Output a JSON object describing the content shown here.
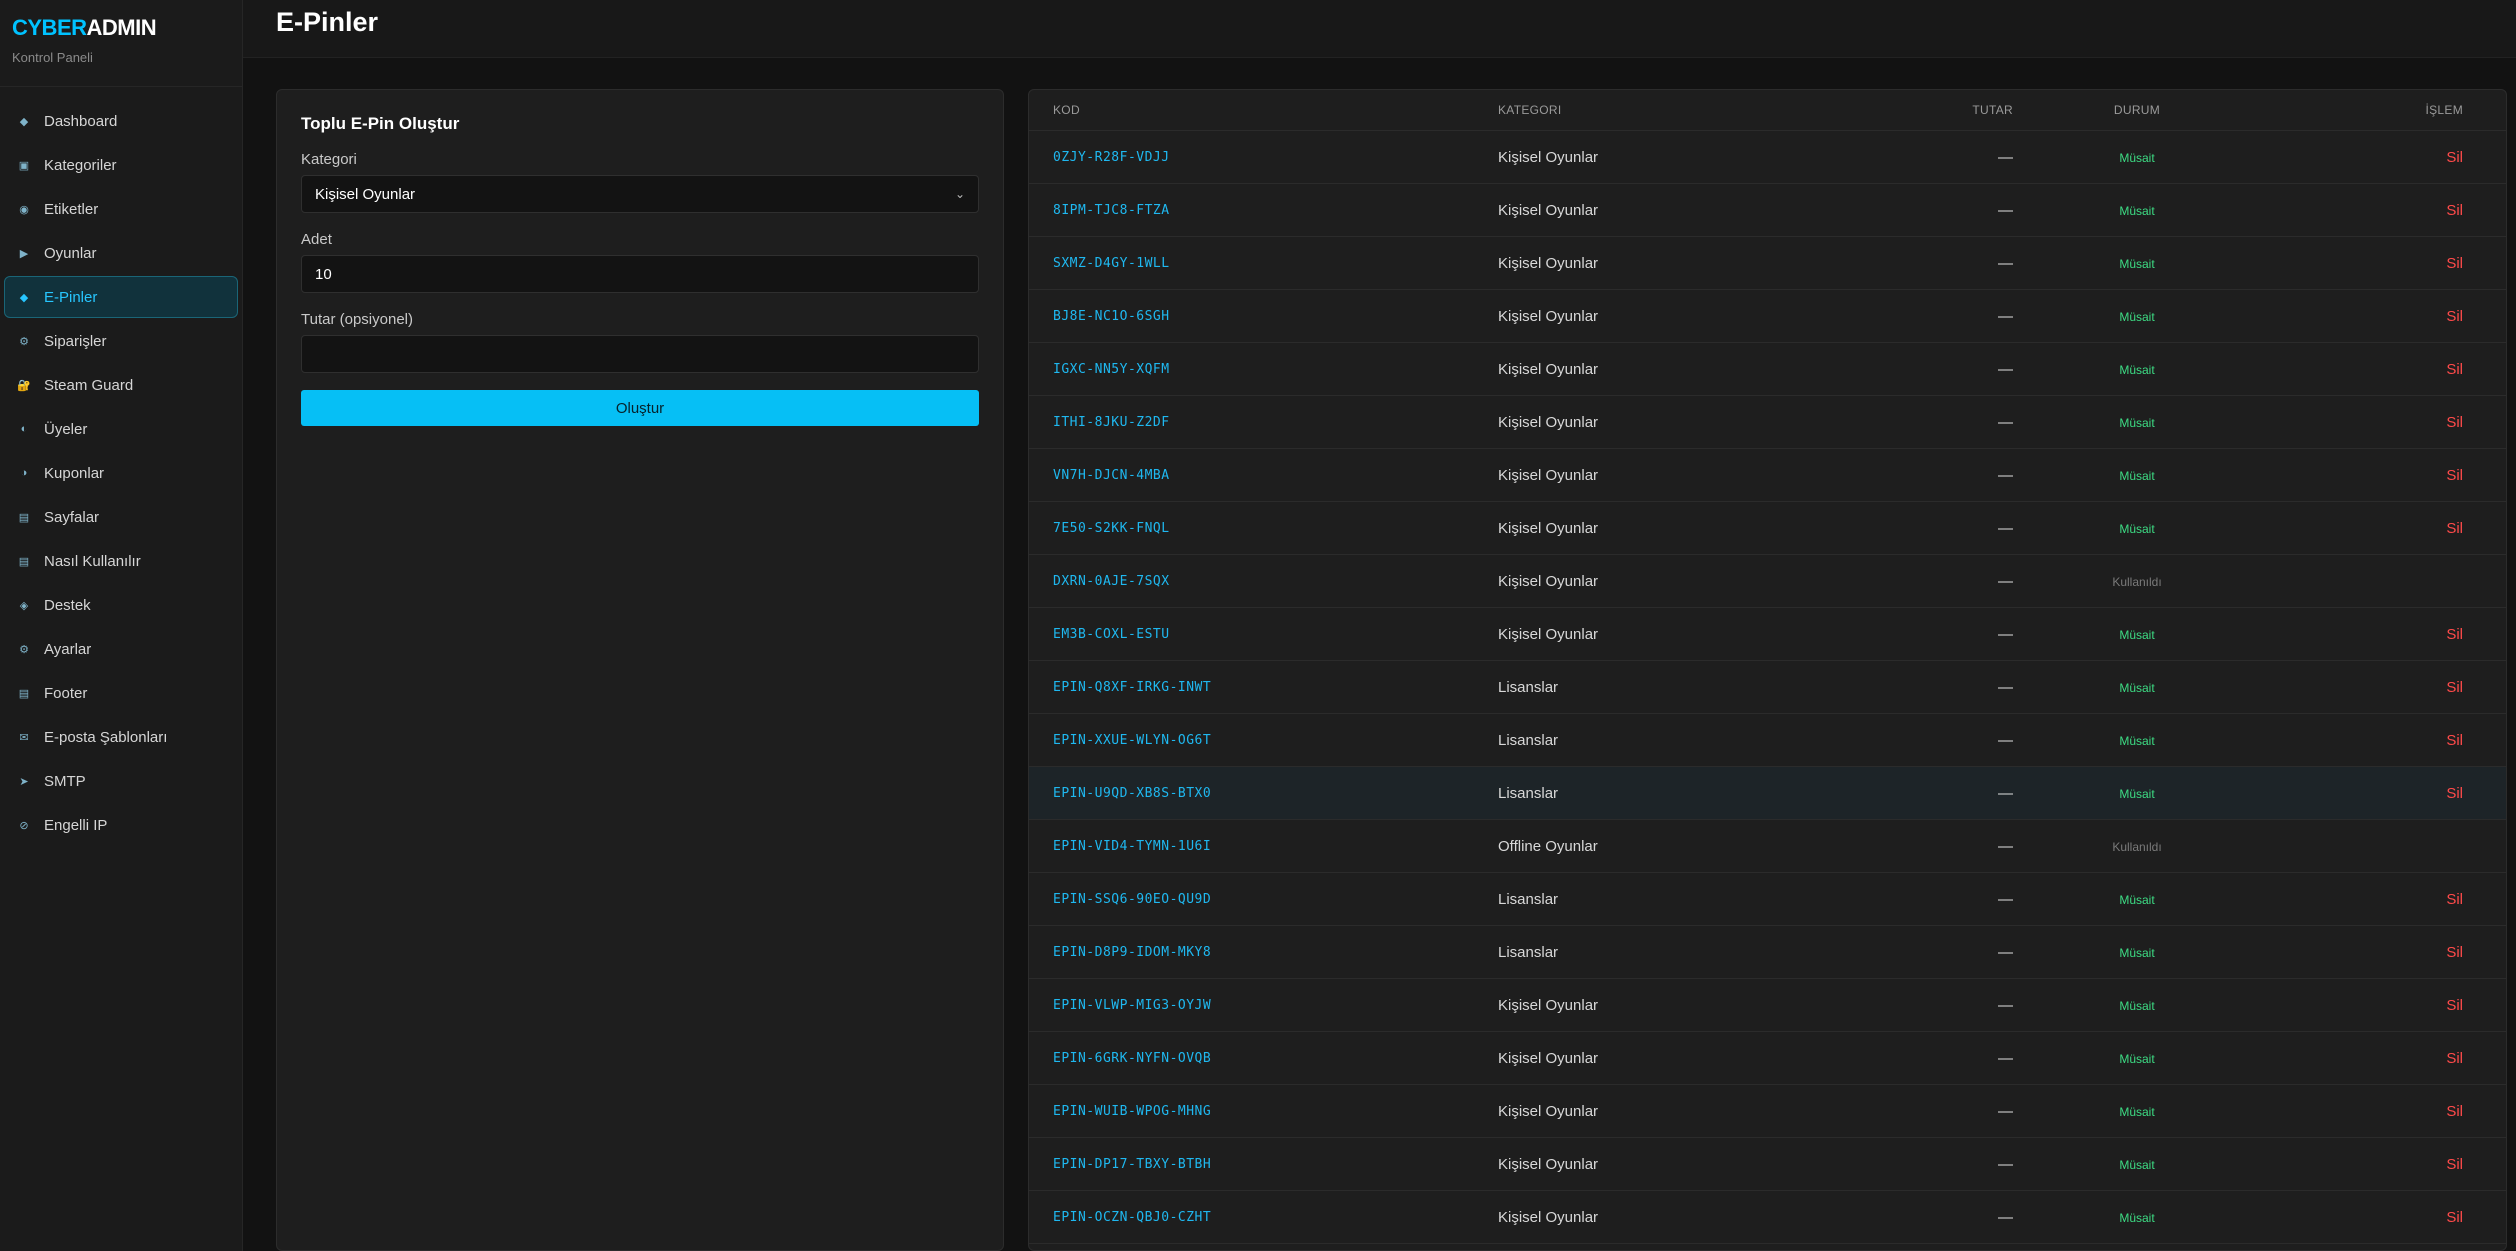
{
  "brand": {
    "part1": "CYBER",
    "part2": "ADMIN",
    "subtitle": "Kontrol Paneli"
  },
  "colors": {
    "accent": "#00c2ff",
    "success": "#3ddc84",
    "danger": "#ff4a4a",
    "background": "#121212"
  },
  "sidebar": {
    "items": [
      {
        "label": "Dashboard",
        "icon": "diamond-icon",
        "glyph": "◆"
      },
      {
        "label": "Kategoriler",
        "icon": "square-icon",
        "glyph": "▣"
      },
      {
        "label": "Etiketler",
        "icon": "tag-icon",
        "glyph": "◉"
      },
      {
        "label": "Oyunlar",
        "icon": "play-icon",
        "glyph": "▶"
      },
      {
        "label": "E-Pinler",
        "icon": "diamond-icon",
        "glyph": "◆",
        "active": true
      },
      {
        "label": "Siparişler",
        "icon": "gear-icon",
        "glyph": "⚙"
      },
      {
        "label": "Steam Guard",
        "icon": "lock-icon",
        "glyph": "🔐"
      },
      {
        "label": "Üyeler",
        "icon": "users-icon",
        "glyph": "◐"
      },
      {
        "label": "Kuponlar",
        "icon": "coupon-icon",
        "glyph": "◑"
      },
      {
        "label": "Sayfalar",
        "icon": "page-icon",
        "glyph": "▤"
      },
      {
        "label": "Nasıl Kullanılır",
        "icon": "list-icon",
        "glyph": "▤"
      },
      {
        "label": "Destek",
        "icon": "support-icon",
        "glyph": "◈"
      },
      {
        "label": "Ayarlar",
        "icon": "settings-icon",
        "glyph": "⚙"
      },
      {
        "label": "Footer",
        "icon": "footer-icon",
        "glyph": "▤"
      },
      {
        "label": "E-posta Şablonları",
        "icon": "mail-icon",
        "glyph": "✉"
      },
      {
        "label": "SMTP",
        "icon": "send-icon",
        "glyph": "➤"
      },
      {
        "label": "Engelli IP",
        "icon": "block-icon",
        "glyph": "⊘"
      }
    ]
  },
  "header": {
    "title": "E-Pinler"
  },
  "form": {
    "title": "Toplu E-Pin Oluştur",
    "category_label": "Kategori",
    "category_value": "Kişisel Oyunlar",
    "count_label": "Adet",
    "count_value": "10",
    "amount_label": "Tutar (opsiyonel)",
    "amount_value": "",
    "submit_label": "Oluştur"
  },
  "table": {
    "columns": {
      "kod": "KOD",
      "kategori": "KATEGORI",
      "tutar": "TUTAR",
      "durum": "DURUM",
      "islem": "İŞLEM"
    },
    "rows": [
      {
        "kod": "0ZJY-R28F-VDJJ",
        "kategori": "Kişisel Oyunlar",
        "tutar": "—",
        "durum": "Müsait",
        "islem": "Sil"
      },
      {
        "kod": "8IPM-TJC8-FTZA",
        "kategori": "Kişisel Oyunlar",
        "tutar": "—",
        "durum": "Müsait",
        "islem": "Sil"
      },
      {
        "kod": "SXMZ-D4GY-1WLL",
        "kategori": "Kişisel Oyunlar",
        "tutar": "—",
        "durum": "Müsait",
        "islem": "Sil"
      },
      {
        "kod": "BJ8E-NC1O-6SGH",
        "kategori": "Kişisel Oyunlar",
        "tutar": "—",
        "durum": "Müsait",
        "islem": "Sil"
      },
      {
        "kod": "IGXC-NN5Y-XQFM",
        "kategori": "Kişisel Oyunlar",
        "tutar": "—",
        "durum": "Müsait",
        "islem": "Sil"
      },
      {
        "kod": "ITHI-8JKU-Z2DF",
        "kategori": "Kişisel Oyunlar",
        "tutar": "—",
        "durum": "Müsait",
        "islem": "Sil"
      },
      {
        "kod": "VN7H-DJCN-4MBA",
        "kategori": "Kişisel Oyunlar",
        "tutar": "—",
        "durum": "Müsait",
        "islem": "Sil"
      },
      {
        "kod": "7E50-S2KK-FNQL",
        "kategori": "Kişisel Oyunlar",
        "tutar": "—",
        "durum": "Müsait",
        "islem": "Sil"
      },
      {
        "kod": "DXRN-0AJE-7SQX",
        "kategori": "Kişisel Oyunlar",
        "tutar": "—",
        "durum": "Kullanıldı",
        "islem": ""
      },
      {
        "kod": "EM3B-COXL-ESTU",
        "kategori": "Kişisel Oyunlar",
        "tutar": "—",
        "durum": "Müsait",
        "islem": "Sil"
      },
      {
        "kod": "EPIN-Q8XF-IRKG-INWT",
        "kategori": "Lisanslar",
        "tutar": "—",
        "durum": "Müsait",
        "islem": "Sil"
      },
      {
        "kod": "EPIN-XXUE-WLYN-OG6T",
        "kategori": "Lisanslar",
        "tutar": "—",
        "durum": "Müsait",
        "islem": "Sil"
      },
      {
        "kod": "EPIN-U9QD-XB8S-BTX0",
        "kategori": "Lisanslar",
        "tutar": "—",
        "durum": "Müsait",
        "islem": "Sil",
        "highlight": true
      },
      {
        "kod": "EPIN-VID4-TYMN-1U6I",
        "kategori": "Offline Oyunlar",
        "tutar": "—",
        "durum": "Kullanıldı",
        "islem": ""
      },
      {
        "kod": "EPIN-SSQ6-90EO-QU9D",
        "kategori": "Lisanslar",
        "tutar": "—",
        "durum": "Müsait",
        "islem": "Sil"
      },
      {
        "kod": "EPIN-D8P9-IDOM-MKY8",
        "kategori": "Lisanslar",
        "tutar": "—",
        "durum": "Müsait",
        "islem": "Sil"
      },
      {
        "kod": "EPIN-VLWP-MIG3-OYJW",
        "kategori": "Kişisel Oyunlar",
        "tutar": "—",
        "durum": "Müsait",
        "islem": "Sil"
      },
      {
        "kod": "EPIN-6GRK-NYFN-OVQB",
        "kategori": "Kişisel Oyunlar",
        "tutar": "—",
        "durum": "Müsait",
        "islem": "Sil"
      },
      {
        "kod": "EPIN-WUIB-WPOG-MHNG",
        "kategori": "Kişisel Oyunlar",
        "tutar": "—",
        "durum": "Müsait",
        "islem": "Sil"
      },
      {
        "kod": "EPIN-DP17-TBXY-BTBH",
        "kategori": "Kişisel Oyunlar",
        "tutar": "—",
        "durum": "Müsait",
        "islem": "Sil"
      },
      {
        "kod": "EPIN-OCZN-QBJ0-CZHT",
        "kategori": "Kişisel Oyunlar",
        "tutar": "—",
        "durum": "Müsait",
        "islem": "Sil"
      }
    ]
  }
}
